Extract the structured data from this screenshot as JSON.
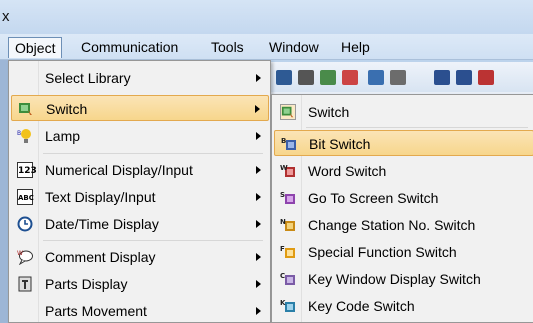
{
  "title": {
    "text": "x"
  },
  "menubar": {
    "items": [
      "Object",
      "Communication",
      "Tools",
      "Window",
      "Help"
    ]
  },
  "object_menu": {
    "items": [
      {
        "label": "Select Library",
        "icon": "none",
        "submenu": true
      },
      {
        "label": "Switch",
        "icon": "switch-icon",
        "submenu": true,
        "highlighted": true
      },
      {
        "label": "Lamp",
        "icon": "lamp-icon",
        "submenu": true
      },
      {
        "label": "Numerical Display/Input",
        "icon": "numerical-icon",
        "icon_text": "123",
        "submenu": true
      },
      {
        "label": "Text Display/Input",
        "icon": "text-icon",
        "icon_text": "ABC",
        "submenu": true
      },
      {
        "label": "Date/Time Display",
        "icon": "clock-icon",
        "submenu": true
      },
      {
        "label": "Comment Display",
        "icon": "comment-icon",
        "submenu": true
      },
      {
        "label": "Parts Display",
        "icon": "parts-icon",
        "submenu": true
      },
      {
        "label": "Parts Movement",
        "icon": "none",
        "submenu": true
      }
    ]
  },
  "switch_submenu": {
    "items": [
      {
        "label": "Switch",
        "icon": "switch-icon"
      },
      {
        "label": "Bit Switch",
        "icon": "bit-switch-icon",
        "icon_text": "B",
        "highlighted": true
      },
      {
        "label": "Word Switch",
        "icon": "word-switch-icon",
        "icon_text": "W"
      },
      {
        "label": "Go To Screen Switch",
        "icon": "go-to-screen-switch-icon",
        "icon_text": "S"
      },
      {
        "label": "Change Station No. Switch",
        "icon": "change-station-switch-icon",
        "icon_text": "N"
      },
      {
        "label": "Special Function Switch",
        "icon": "special-function-switch-icon",
        "icon_text": "F"
      },
      {
        "label": "Key Window Display Switch",
        "icon": "key-window-switch-icon",
        "icon_text": "C"
      },
      {
        "label": "Key Code Switch",
        "icon": "key-code-switch-icon",
        "icon_text": "K"
      }
    ]
  },
  "colors": {
    "highlight": "#f7d68c",
    "highlight_border": "#e3a94e",
    "menu_bg": "#f1f1f1",
    "menubar_bg": "#cfe0f3"
  }
}
